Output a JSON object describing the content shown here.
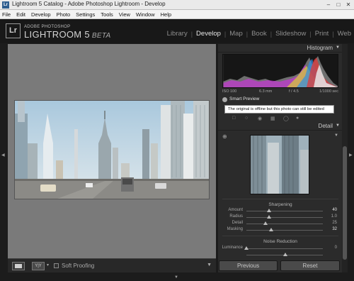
{
  "window": {
    "title": "Lightroom 5 Catalog - Adobe Photoshop Lightroom - Develop",
    "app_icon": "Lr",
    "controls": [
      "minimize-icon",
      "maximize-icon",
      "close-icon"
    ]
  },
  "menu": [
    "File",
    "Edit",
    "Develop",
    "Photo",
    "Settings",
    "Tools",
    "View",
    "Window",
    "Help"
  ],
  "identity": {
    "logo": "Lr",
    "small": "ADOBE PHOTOSHOP",
    "big": "LIGHTROOM 5",
    "beta": "BETA"
  },
  "modules": {
    "items": [
      "Library",
      "Develop",
      "Map",
      "Book",
      "Slideshow",
      "Print",
      "Web"
    ],
    "active": "Develop"
  },
  "toolbar": {
    "soft_proofing": "Soft Proofing",
    "yy_label": "Y|Y"
  },
  "histogram": {
    "title": "Histogram",
    "exif": {
      "iso": "ISO 100",
      "focal": "6.3 mm",
      "aperture": "f / 4.5",
      "shutter": "1/1000 sec"
    }
  },
  "smart_preview": {
    "label": "Smart Preview",
    "tooltip": "The original is offline but this photo can still be edited"
  },
  "detail": {
    "title": "Detail",
    "sharpening": {
      "title": "Sharpening",
      "rows": [
        {
          "label": "Amount",
          "value": "40",
          "level": 0.27
        },
        {
          "label": "Radius",
          "value": "1.0",
          "level": 0.3
        },
        {
          "label": "Detail",
          "value": "25",
          "level": 0.25
        },
        {
          "label": "Masking",
          "value": "32",
          "level": 0.32
        }
      ]
    },
    "noise_reduction": {
      "title": "Noise Reduction",
      "rows": [
        {
          "label": "Luminance",
          "value": "0",
          "level": 0.0
        }
      ]
    }
  },
  "buttons": {
    "previous": "Previous",
    "reset": "Reset"
  },
  "colors": {
    "accent_text": "#e6e6e6",
    "panel_bg": "#2b2b2b",
    "center_bg": "#7a7a7a"
  }
}
